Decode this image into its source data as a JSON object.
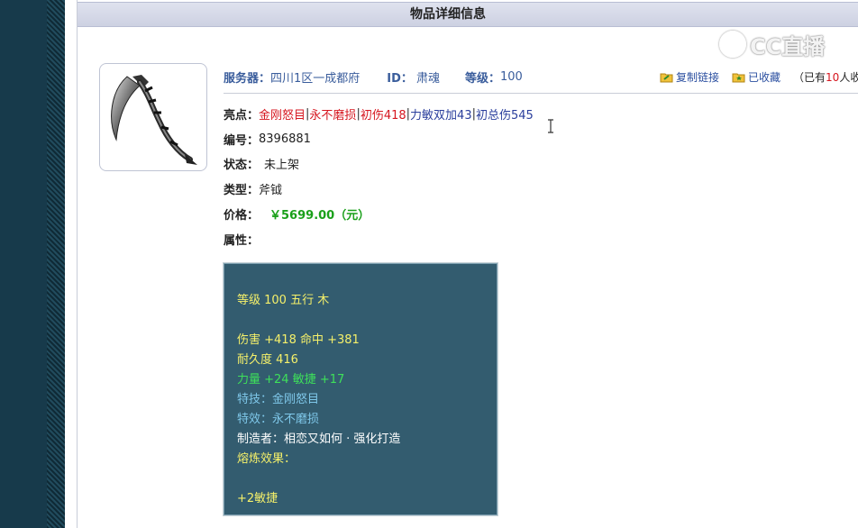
{
  "panel": {
    "title": "物品详细信息"
  },
  "watermark": {
    "text": "CC直播"
  },
  "meta": {
    "server_label": "服务器：",
    "server_value": "四川1区一成都府",
    "id_label": "ID：",
    "id_value": "肃魂",
    "level_label": "等级：",
    "level_value": "100"
  },
  "actions": {
    "copy_link": "复制链接",
    "favorited": "已收藏",
    "fav_prefix": "（已有",
    "fav_count": "10",
    "fav_suffix": "人收藏"
  },
  "highlights": {
    "label": "亮点：",
    "items": [
      "金刚怒目",
      "永不磨损",
      "初伤418",
      "力敏双加43",
      "初总伤545"
    ],
    "separator": "|"
  },
  "fields": {
    "serial_label": "编号：",
    "serial_value": "8396881",
    "status_label": "状态：",
    "status_value": "未上架",
    "type_label": "类型：",
    "type_value": "斧钺",
    "price_label": "价格：",
    "price_value": "￥5699.00（元）",
    "attr_label": "属性："
  },
  "stats": {
    "level_line": "等级 100 五行 木",
    "damage_line": "伤害 +418 命中 +381",
    "durability_line": "耐久度 416",
    "str_agi_line": "力量 +24 敏捷 +17",
    "skill_line": "特技：金刚怒目",
    "effect_line": "特效：永不磨损",
    "maker_line": "制造者：相恋又如何 · 强化打造",
    "smelt_line": "熔炼效果：",
    "bonus_line": "+2敏捷"
  },
  "colors": {
    "sidebar": "#173a4b",
    "stats_bg": "#335c6f",
    "label_blue": "#3a5d9c",
    "highlight_red": "#d6161f",
    "price_green": "#1aa01a",
    "stat_yellow": "#f5f06a"
  }
}
